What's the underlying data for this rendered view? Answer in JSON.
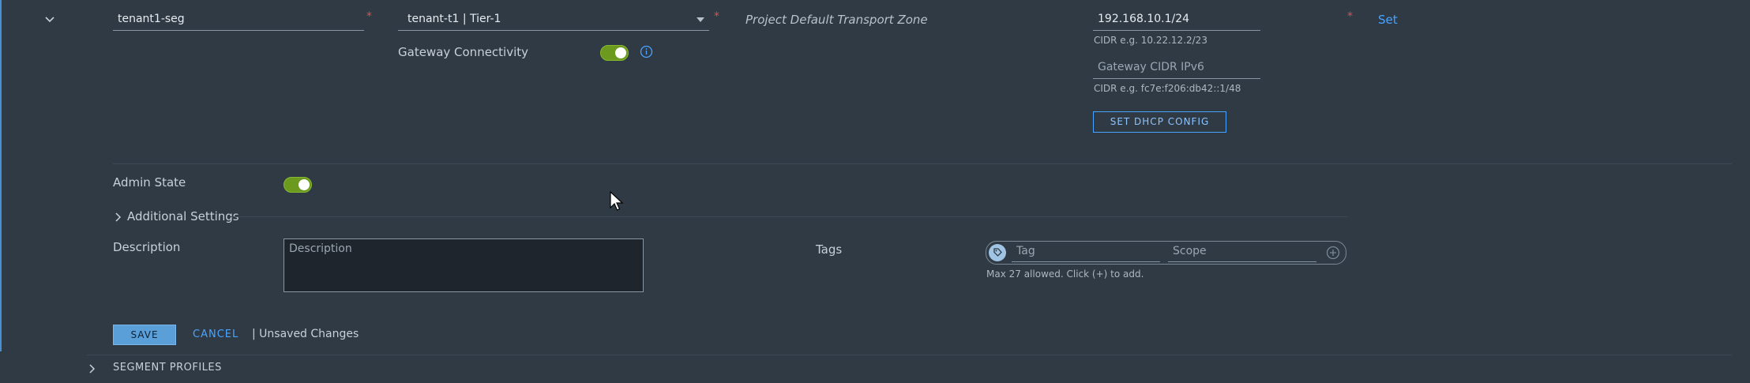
{
  "row": {
    "segment_name": "tenant1-seg",
    "connected_gateway": "tenant-t1 | Tier-1",
    "transport_zone": "Project Default Transport Zone",
    "subnet_ipv4": "192.168.10.1/24",
    "subnet_ipv4_hint": "CIDR e.g. 10.22.12.2/23",
    "subnet_ipv6_placeholder": "Gateway CIDR IPv6",
    "subnet_ipv6_hint": "CIDR e.g. fc7e:f206:db42::1/48",
    "set_dhcp_label": "SET DHCP CONFIG",
    "set_link": "Set",
    "gateway_connectivity_label": "Gateway Connectivity",
    "gateway_connectivity_on": true,
    "required_mark": "*"
  },
  "details": {
    "admin_state_label": "Admin State",
    "admin_state_on": true,
    "additional_settings_label": "Additional Settings",
    "description_label": "Description",
    "description_placeholder": "Description",
    "tags_label": "Tags",
    "tag_placeholder": "Tag",
    "scope_placeholder": "Scope",
    "tags_hint": "Max 27 allowed. Click (+) to add."
  },
  "actions": {
    "save": "SAVE",
    "cancel": "CANCEL",
    "status": "| Unsaved Changes"
  },
  "sections": {
    "segment_profiles": "SEGMENT PROFILES"
  },
  "colors": {
    "background": "#2f3a45",
    "accent": "#4aa3ff",
    "toggle_on": "#6b9a1f",
    "required": "#d9534f"
  }
}
